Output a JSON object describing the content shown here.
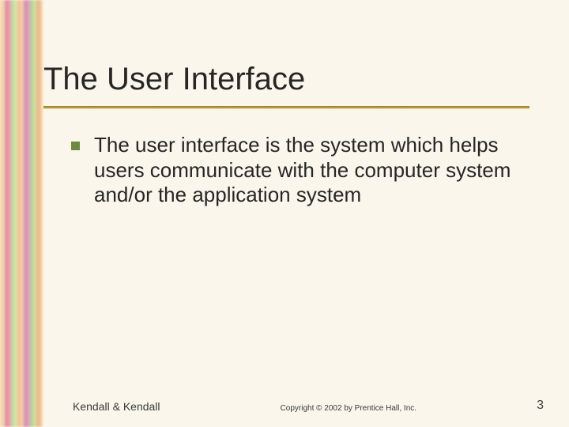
{
  "title": "The User Interface",
  "bullets": [
    {
      "text": "The user interface is the system which helps users communicate with the computer system and/or the application system"
    }
  ],
  "footer": {
    "left": "Kendall & Kendall",
    "center": "Copyright © 2002 by Prentice Hall, Inc.",
    "page": "3"
  }
}
